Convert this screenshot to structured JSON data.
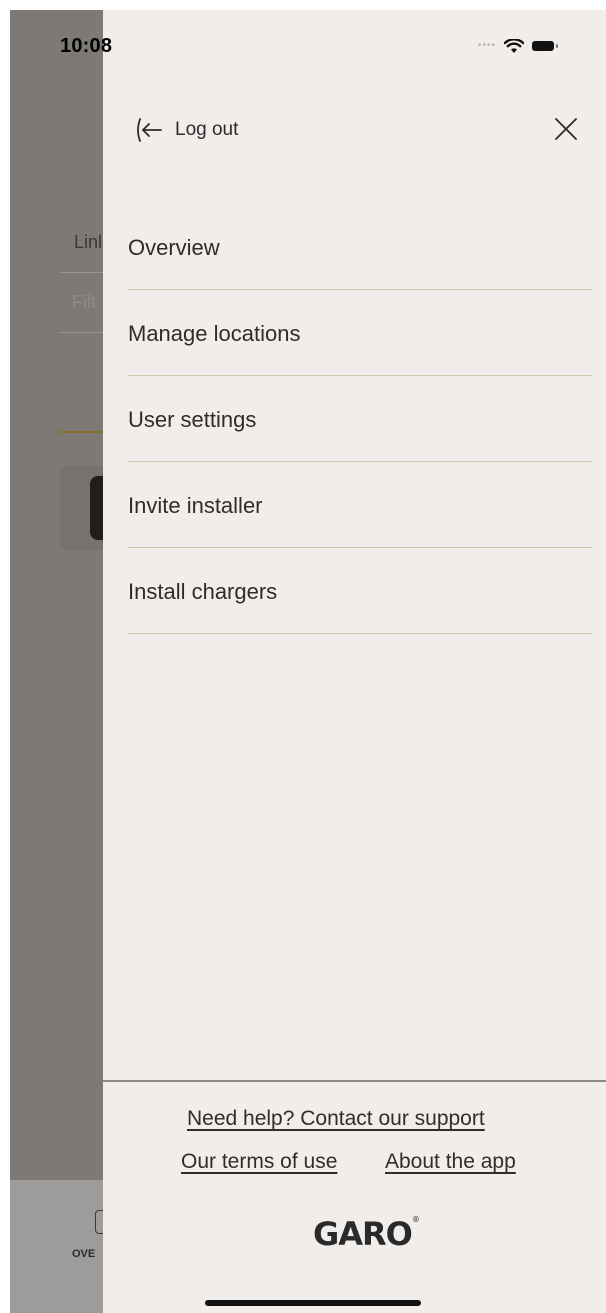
{
  "status_bar": {
    "time": "10:08"
  },
  "background": {
    "tab_label": "Linl",
    "filter_placeholder": "Filt",
    "nav_label": "OVE"
  },
  "drawer": {
    "logout_label": "Log out",
    "menu": [
      {
        "label": "Overview"
      },
      {
        "label": "Manage locations"
      },
      {
        "label": "User settings"
      },
      {
        "label": "Invite installer"
      },
      {
        "label": "Install chargers"
      }
    ],
    "footer": {
      "support_link": "Need help? Contact our support",
      "terms_link": "Our terms of use",
      "about_link": "About the app",
      "logo_text": "GARO"
    }
  },
  "colors": {
    "drawer_bg": "#f1edeb",
    "menu_divider": "#d6c8ad",
    "overlay": "#7d7a76",
    "accent": "#8a6f2a"
  },
  "icons": {
    "logout": "logout-arrow-icon",
    "close": "close-icon",
    "wifi": "wifi-icon",
    "battery": "battery-icon"
  }
}
